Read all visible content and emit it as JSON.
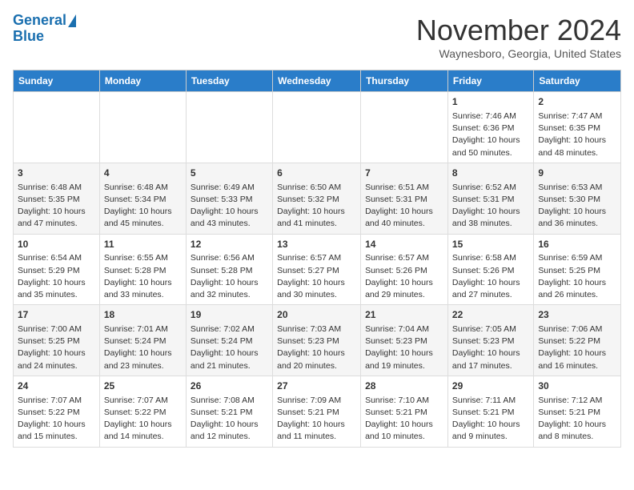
{
  "header": {
    "logo_line1": "General",
    "logo_line2": "Blue",
    "month_title": "November 2024",
    "location": "Waynesboro, Georgia, United States"
  },
  "days_of_week": [
    "Sunday",
    "Monday",
    "Tuesday",
    "Wednesday",
    "Thursday",
    "Friday",
    "Saturday"
  ],
  "weeks": [
    [
      {
        "day": "",
        "info": ""
      },
      {
        "day": "",
        "info": ""
      },
      {
        "day": "",
        "info": ""
      },
      {
        "day": "",
        "info": ""
      },
      {
        "day": "",
        "info": ""
      },
      {
        "day": "1",
        "info": "Sunrise: 7:46 AM\nSunset: 6:36 PM\nDaylight: 10 hours\nand 50 minutes."
      },
      {
        "day": "2",
        "info": "Sunrise: 7:47 AM\nSunset: 6:35 PM\nDaylight: 10 hours\nand 48 minutes."
      }
    ],
    [
      {
        "day": "3",
        "info": "Sunrise: 6:48 AM\nSunset: 5:35 PM\nDaylight: 10 hours\nand 47 minutes."
      },
      {
        "day": "4",
        "info": "Sunrise: 6:48 AM\nSunset: 5:34 PM\nDaylight: 10 hours\nand 45 minutes."
      },
      {
        "day": "5",
        "info": "Sunrise: 6:49 AM\nSunset: 5:33 PM\nDaylight: 10 hours\nand 43 minutes."
      },
      {
        "day": "6",
        "info": "Sunrise: 6:50 AM\nSunset: 5:32 PM\nDaylight: 10 hours\nand 41 minutes."
      },
      {
        "day": "7",
        "info": "Sunrise: 6:51 AM\nSunset: 5:31 PM\nDaylight: 10 hours\nand 40 minutes."
      },
      {
        "day": "8",
        "info": "Sunrise: 6:52 AM\nSunset: 5:31 PM\nDaylight: 10 hours\nand 38 minutes."
      },
      {
        "day": "9",
        "info": "Sunrise: 6:53 AM\nSunset: 5:30 PM\nDaylight: 10 hours\nand 36 minutes."
      }
    ],
    [
      {
        "day": "10",
        "info": "Sunrise: 6:54 AM\nSunset: 5:29 PM\nDaylight: 10 hours\nand 35 minutes."
      },
      {
        "day": "11",
        "info": "Sunrise: 6:55 AM\nSunset: 5:28 PM\nDaylight: 10 hours\nand 33 minutes."
      },
      {
        "day": "12",
        "info": "Sunrise: 6:56 AM\nSunset: 5:28 PM\nDaylight: 10 hours\nand 32 minutes."
      },
      {
        "day": "13",
        "info": "Sunrise: 6:57 AM\nSunset: 5:27 PM\nDaylight: 10 hours\nand 30 minutes."
      },
      {
        "day": "14",
        "info": "Sunrise: 6:57 AM\nSunset: 5:26 PM\nDaylight: 10 hours\nand 29 minutes."
      },
      {
        "day": "15",
        "info": "Sunrise: 6:58 AM\nSunset: 5:26 PM\nDaylight: 10 hours\nand 27 minutes."
      },
      {
        "day": "16",
        "info": "Sunrise: 6:59 AM\nSunset: 5:25 PM\nDaylight: 10 hours\nand 26 minutes."
      }
    ],
    [
      {
        "day": "17",
        "info": "Sunrise: 7:00 AM\nSunset: 5:25 PM\nDaylight: 10 hours\nand 24 minutes."
      },
      {
        "day": "18",
        "info": "Sunrise: 7:01 AM\nSunset: 5:24 PM\nDaylight: 10 hours\nand 23 minutes."
      },
      {
        "day": "19",
        "info": "Sunrise: 7:02 AM\nSunset: 5:24 PM\nDaylight: 10 hours\nand 21 minutes."
      },
      {
        "day": "20",
        "info": "Sunrise: 7:03 AM\nSunset: 5:23 PM\nDaylight: 10 hours\nand 20 minutes."
      },
      {
        "day": "21",
        "info": "Sunrise: 7:04 AM\nSunset: 5:23 PM\nDaylight: 10 hours\nand 19 minutes."
      },
      {
        "day": "22",
        "info": "Sunrise: 7:05 AM\nSunset: 5:23 PM\nDaylight: 10 hours\nand 17 minutes."
      },
      {
        "day": "23",
        "info": "Sunrise: 7:06 AM\nSunset: 5:22 PM\nDaylight: 10 hours\nand 16 minutes."
      }
    ],
    [
      {
        "day": "24",
        "info": "Sunrise: 7:07 AM\nSunset: 5:22 PM\nDaylight: 10 hours\nand 15 minutes."
      },
      {
        "day": "25",
        "info": "Sunrise: 7:07 AM\nSunset: 5:22 PM\nDaylight: 10 hours\nand 14 minutes."
      },
      {
        "day": "26",
        "info": "Sunrise: 7:08 AM\nSunset: 5:21 PM\nDaylight: 10 hours\nand 12 minutes."
      },
      {
        "day": "27",
        "info": "Sunrise: 7:09 AM\nSunset: 5:21 PM\nDaylight: 10 hours\nand 11 minutes."
      },
      {
        "day": "28",
        "info": "Sunrise: 7:10 AM\nSunset: 5:21 PM\nDaylight: 10 hours\nand 10 minutes."
      },
      {
        "day": "29",
        "info": "Sunrise: 7:11 AM\nSunset: 5:21 PM\nDaylight: 10 hours\nand 9 minutes."
      },
      {
        "day": "30",
        "info": "Sunrise: 7:12 AM\nSunset: 5:21 PM\nDaylight: 10 hours\nand 8 minutes."
      }
    ]
  ]
}
